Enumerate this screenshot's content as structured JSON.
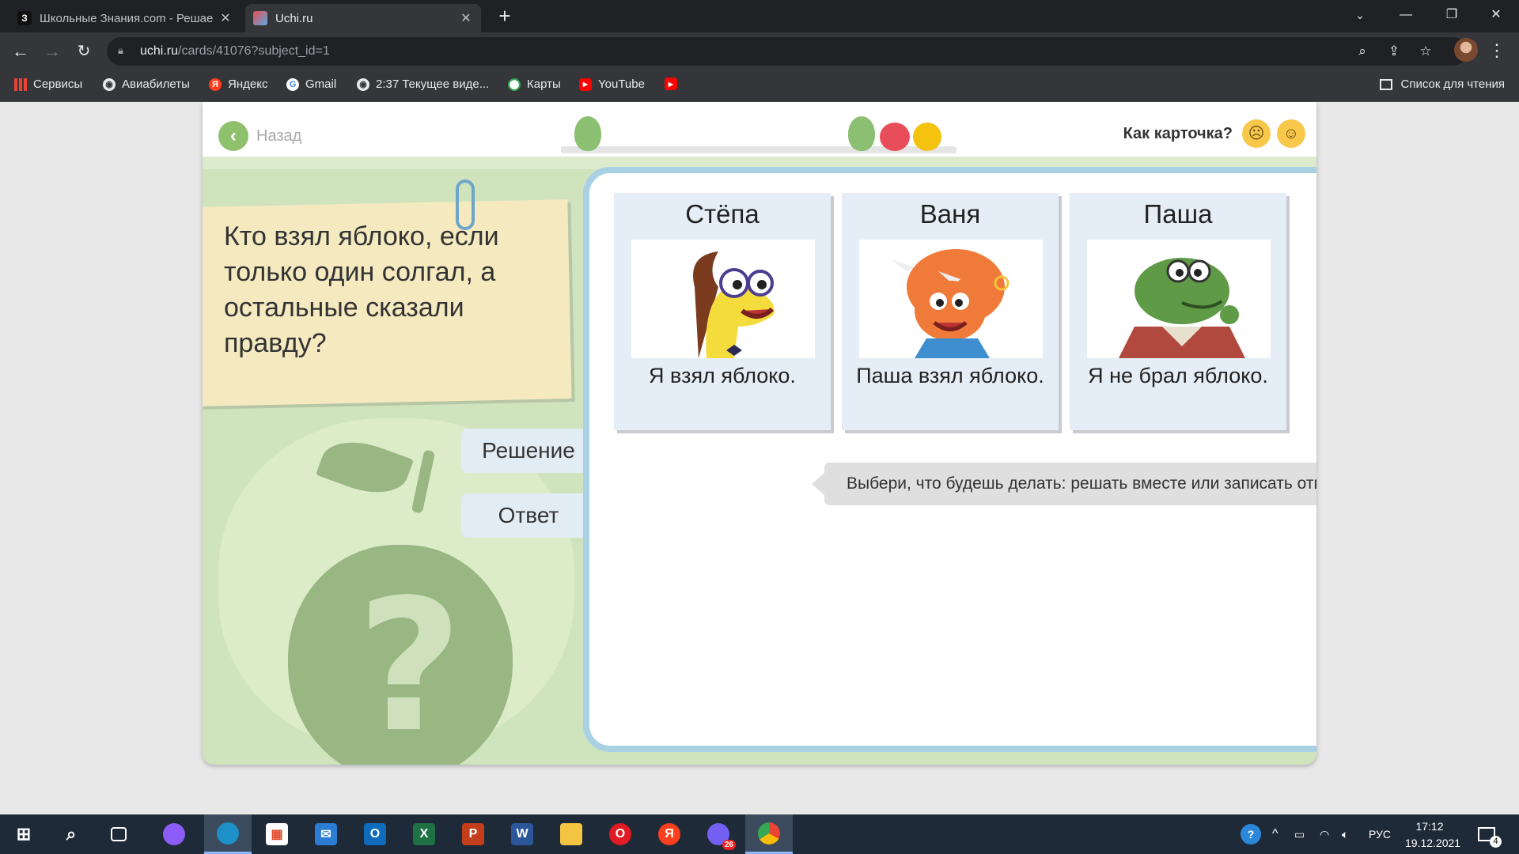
{
  "browser": {
    "tabs": [
      {
        "favicon": "З",
        "title": "Школьные Знания.com - Решае"
      },
      {
        "favicon": "",
        "title": "Uchi.ru"
      }
    ],
    "url_host": "uchi.ru",
    "url_path": "/cards/41076?subject_id=1",
    "bookmarks": [
      "Сервисы",
      "Авиабилеты",
      "Яндекс",
      "Gmail",
      "2:37 Текущее виде...",
      "Карты",
      "YouTube"
    ],
    "reading_list": "Список для чтения"
  },
  "page": {
    "back_label": "Назад",
    "rate_question": "Как карточка?",
    "question": "Кто взял яблоко, если только один солгал, а остальные сказали правду?",
    "buttons": {
      "solution": "Решение",
      "answer": "Ответ"
    },
    "characters": [
      {
        "name": "Стёпа",
        "quote": "Я взял яблоко."
      },
      {
        "name": "Ваня",
        "quote": "Паша взял яблоко."
      },
      {
        "name": "Паша",
        "quote": "Я не брал яблоко."
      }
    ],
    "hint": "Выбери, что будешь делать: решать вместе или записать ответ сразу."
  },
  "taskbar": {
    "lang": "РУС",
    "time": "17:12",
    "date": "19.12.2021",
    "viber_badge": "26",
    "notification_count": "4"
  },
  "colors": {
    "card_bg": "#cfe3bd",
    "accent_green": "#8fc16d",
    "board_border": "#a9d1e4",
    "note_bg": "#f5e9c0"
  }
}
